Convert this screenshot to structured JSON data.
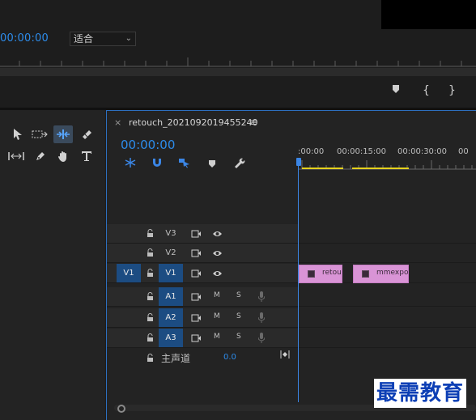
{
  "program_monitor": {
    "timecode": "00:00:00",
    "fit_select": "适合",
    "transport_icons": [
      "marker-icon",
      "mark-in-icon",
      "mark-out-icon"
    ],
    "transport_glyphs": [
      "{",
      "}"
    ]
  },
  "tools": [
    "selection-tool-icon",
    "track-select-tool-icon",
    "ripple-edit-tool-icon",
    "razor-tool-icon",
    "slip-tool-icon",
    "pen-tool-icon",
    "hand-tool-icon",
    "type-tool-icon"
  ],
  "timeline": {
    "tab_close": "×",
    "tab_title": "retouch_2021092019455240",
    "tab_menu": "≡",
    "timecode": "00:00:00",
    "ruler_labels": [
      ":00:00",
      "00:00:15:00",
      "00:00:30:00",
      "00"
    ],
    "tracks": [
      {
        "name": "V3",
        "type": "video",
        "active": false
      },
      {
        "name": "V2",
        "type": "video",
        "active": false
      },
      {
        "name": "V1",
        "type": "video",
        "active": true,
        "source": "V1"
      },
      {
        "name": "A1",
        "type": "audio",
        "active": true,
        "m": "M",
        "s": "S"
      },
      {
        "name": "A2",
        "type": "audio",
        "active": true,
        "m": "M",
        "s": "S"
      },
      {
        "name": "A3",
        "type": "audio",
        "active": true,
        "m": "M",
        "s": "S"
      }
    ],
    "clips": [
      {
        "label": "retou"
      },
      {
        "label": "mmexpo"
      }
    ],
    "master": {
      "label": "主声道",
      "value": "0.0"
    }
  },
  "colors": {
    "accent_blue": "#2d8ceb",
    "clip_pink": "#d994d6",
    "track_active": "#1c4c82",
    "work_area_yellow": "#e6d21c"
  },
  "watermark": "最需教育"
}
